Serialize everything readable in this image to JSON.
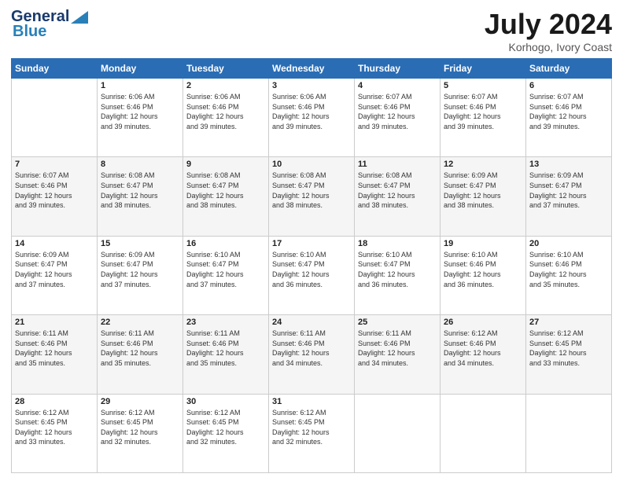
{
  "logo": {
    "line1": "General",
    "line2": "Blue"
  },
  "title": "July 2024",
  "subtitle": "Korhogo, Ivory Coast",
  "days_of_week": [
    "Sunday",
    "Monday",
    "Tuesday",
    "Wednesday",
    "Thursday",
    "Friday",
    "Saturday"
  ],
  "weeks": [
    [
      {
        "day": "",
        "info": ""
      },
      {
        "day": "1",
        "info": "Sunrise: 6:06 AM\nSunset: 6:46 PM\nDaylight: 12 hours\nand 39 minutes."
      },
      {
        "day": "2",
        "info": "Sunrise: 6:06 AM\nSunset: 6:46 PM\nDaylight: 12 hours\nand 39 minutes."
      },
      {
        "day": "3",
        "info": "Sunrise: 6:06 AM\nSunset: 6:46 PM\nDaylight: 12 hours\nand 39 minutes."
      },
      {
        "day": "4",
        "info": "Sunrise: 6:07 AM\nSunset: 6:46 PM\nDaylight: 12 hours\nand 39 minutes."
      },
      {
        "day": "5",
        "info": "Sunrise: 6:07 AM\nSunset: 6:46 PM\nDaylight: 12 hours\nand 39 minutes."
      },
      {
        "day": "6",
        "info": "Sunrise: 6:07 AM\nSunset: 6:46 PM\nDaylight: 12 hours\nand 39 minutes."
      }
    ],
    [
      {
        "day": "7",
        "info": "Sunrise: 6:07 AM\nSunset: 6:46 PM\nDaylight: 12 hours\nand 39 minutes."
      },
      {
        "day": "8",
        "info": "Sunrise: 6:08 AM\nSunset: 6:47 PM\nDaylight: 12 hours\nand 38 minutes."
      },
      {
        "day": "9",
        "info": "Sunrise: 6:08 AM\nSunset: 6:47 PM\nDaylight: 12 hours\nand 38 minutes."
      },
      {
        "day": "10",
        "info": "Sunrise: 6:08 AM\nSunset: 6:47 PM\nDaylight: 12 hours\nand 38 minutes."
      },
      {
        "day": "11",
        "info": "Sunrise: 6:08 AM\nSunset: 6:47 PM\nDaylight: 12 hours\nand 38 minutes."
      },
      {
        "day": "12",
        "info": "Sunrise: 6:09 AM\nSunset: 6:47 PM\nDaylight: 12 hours\nand 38 minutes."
      },
      {
        "day": "13",
        "info": "Sunrise: 6:09 AM\nSunset: 6:47 PM\nDaylight: 12 hours\nand 37 minutes."
      }
    ],
    [
      {
        "day": "14",
        "info": "Sunrise: 6:09 AM\nSunset: 6:47 PM\nDaylight: 12 hours\nand 37 minutes."
      },
      {
        "day": "15",
        "info": "Sunrise: 6:09 AM\nSunset: 6:47 PM\nDaylight: 12 hours\nand 37 minutes."
      },
      {
        "day": "16",
        "info": "Sunrise: 6:10 AM\nSunset: 6:47 PM\nDaylight: 12 hours\nand 37 minutes."
      },
      {
        "day": "17",
        "info": "Sunrise: 6:10 AM\nSunset: 6:47 PM\nDaylight: 12 hours\nand 36 minutes."
      },
      {
        "day": "18",
        "info": "Sunrise: 6:10 AM\nSunset: 6:47 PM\nDaylight: 12 hours\nand 36 minutes."
      },
      {
        "day": "19",
        "info": "Sunrise: 6:10 AM\nSunset: 6:46 PM\nDaylight: 12 hours\nand 36 minutes."
      },
      {
        "day": "20",
        "info": "Sunrise: 6:10 AM\nSunset: 6:46 PM\nDaylight: 12 hours\nand 35 minutes."
      }
    ],
    [
      {
        "day": "21",
        "info": "Sunrise: 6:11 AM\nSunset: 6:46 PM\nDaylight: 12 hours\nand 35 minutes."
      },
      {
        "day": "22",
        "info": "Sunrise: 6:11 AM\nSunset: 6:46 PM\nDaylight: 12 hours\nand 35 minutes."
      },
      {
        "day": "23",
        "info": "Sunrise: 6:11 AM\nSunset: 6:46 PM\nDaylight: 12 hours\nand 35 minutes."
      },
      {
        "day": "24",
        "info": "Sunrise: 6:11 AM\nSunset: 6:46 PM\nDaylight: 12 hours\nand 34 minutes."
      },
      {
        "day": "25",
        "info": "Sunrise: 6:11 AM\nSunset: 6:46 PM\nDaylight: 12 hours\nand 34 minutes."
      },
      {
        "day": "26",
        "info": "Sunrise: 6:12 AM\nSunset: 6:46 PM\nDaylight: 12 hours\nand 34 minutes."
      },
      {
        "day": "27",
        "info": "Sunrise: 6:12 AM\nSunset: 6:45 PM\nDaylight: 12 hours\nand 33 minutes."
      }
    ],
    [
      {
        "day": "28",
        "info": "Sunrise: 6:12 AM\nSunset: 6:45 PM\nDaylight: 12 hours\nand 33 minutes."
      },
      {
        "day": "29",
        "info": "Sunrise: 6:12 AM\nSunset: 6:45 PM\nDaylight: 12 hours\nand 32 minutes."
      },
      {
        "day": "30",
        "info": "Sunrise: 6:12 AM\nSunset: 6:45 PM\nDaylight: 12 hours\nand 32 minutes."
      },
      {
        "day": "31",
        "info": "Sunrise: 6:12 AM\nSunset: 6:45 PM\nDaylight: 12 hours\nand 32 minutes."
      },
      {
        "day": "",
        "info": ""
      },
      {
        "day": "",
        "info": ""
      },
      {
        "day": "",
        "info": ""
      }
    ]
  ]
}
